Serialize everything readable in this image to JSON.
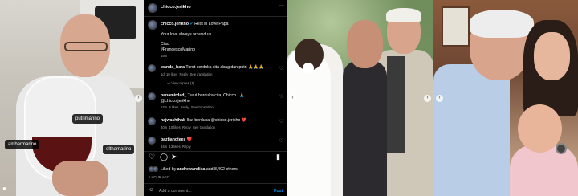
{
  "photo1": {
    "tags": [
      "putrimarino",
      "ambarmarino",
      "olthamarino"
    ],
    "person_icon": "person-tag-icon"
  },
  "post": {
    "username": "chicco.jerikho",
    "caption_lines": [
      "Rest in Love Papa",
      "Your love always around us",
      "Ciao",
      "#FrancescoMarino"
    ],
    "caption_time": "15m",
    "comments": [
      {
        "user": "wanda_hara",
        "text": "Turut berduka cita abag dan putri 🙏🙏🙏",
        "time": "1d",
        "likes": "10 likes",
        "reply": "Reply",
        "translate": "See translation",
        "view_replies": "View replies (1)"
      },
      {
        "user": "nanamirdad_",
        "text": "Turut berduka cita, Chicco...🙏",
        "mention": "@chicco.jerikho",
        "time": "17m",
        "likes": "6 likes",
        "reply": "Reply",
        "translate": "See translation"
      },
      {
        "user": "najwashihab",
        "text": "Ikut berduka @chicco.jerikho ❤️",
        "time": "40m",
        "likes": "10 likes",
        "reply": "Reply",
        "translate": "See translation"
      },
      {
        "user": "baztianotees",
        "text": "❤️",
        "time": "34m",
        "likes": "13 likes",
        "reply": "Reply"
      }
    ],
    "liked_by_prefix": "Liked by",
    "liked_by_user": "andrewandika",
    "liked_by_suffix": "and 8,402 others",
    "post_time": "1 HOUR AGO",
    "add_comment_placeholder": "Add a comment...",
    "post_button": "Post",
    "icons": {
      "like": "heart-icon",
      "comment": "comment-icon",
      "share": "share-icon",
      "save": "bookmark-icon",
      "emoji": "emoji-icon"
    }
  },
  "colors": {
    "ig_bg": "#000000",
    "link": "#0095f6",
    "heart_red": "#ed4956",
    "muted": "#a8a8a8"
  }
}
